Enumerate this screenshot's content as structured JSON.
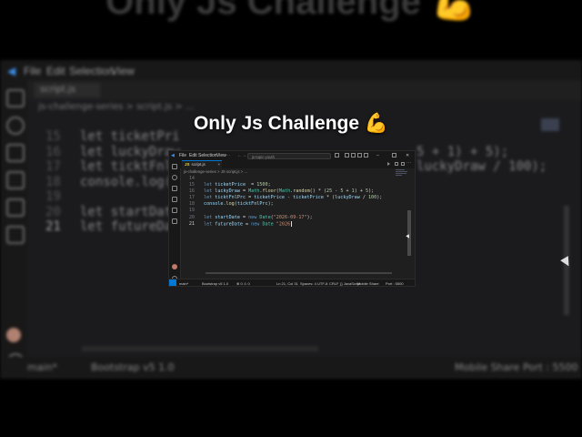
{
  "video": {
    "overlay_title": "Only Js Challenge 💪",
    "top_caption_partial": "Only Js Challenge 💪"
  },
  "background": {
    "menu": [
      "File",
      "Edit",
      "Selection",
      "View"
    ],
    "tab_label": "script.js",
    "breadcrumb": "js-challenge-series > script.js > ...",
    "code_left": [
      {
        "ln": "15",
        "text": "let ticketPri"
      },
      {
        "ln": "16",
        "text": "let luckyDraw"
      },
      {
        "ln": "17",
        "text": "let ticktFnlP"
      },
      {
        "ln": "18",
        "text": "console.log(t"
      },
      {
        "ln": "19",
        "text": ""
      },
      {
        "ln": "20",
        "text": "let startDate"
      },
      {
        "ln": "21",
        "text": "let futureDat"
      }
    ],
    "code_right": [
      "",
      "5 + 1) + 5);",
      "luckyDraw / 100);",
      "",
      "",
      "",
      ""
    ],
    "status": {
      "branch": "main*",
      "bootstrap": "Bootstrap v5 1.0",
      "mobile": "Mobile Share",
      "port": "Port : 5500"
    }
  },
  "editor": {
    "menu": [
      "File",
      "Edit",
      "Selection",
      "View"
    ],
    "search_placeholder": "js-topic-youth",
    "tab": {
      "icon": "JS",
      "label": "script.js",
      "close": "×"
    },
    "breadcrumb": "js-challenge-series > JS script.js > ...",
    "lines": [
      {
        "n": "14",
        "tokens": []
      },
      {
        "n": "15",
        "tokens": [
          [
            "kw",
            "let "
          ],
          [
            "var",
            "ticketPrice"
          ],
          [
            "",
            "  = "
          ],
          [
            "num",
            "1500"
          ],
          [
            "",
            ";"
          ]
        ]
      },
      {
        "n": "16",
        "tokens": [
          [
            "kw",
            "let "
          ],
          [
            "var",
            "luckyDraw"
          ],
          [
            "",
            " = "
          ],
          [
            "cls",
            "Math"
          ],
          [
            "",
            "."
          ],
          [
            "fn",
            "floor"
          ],
          [
            "",
            "("
          ],
          [
            "cls",
            "Math"
          ],
          [
            "",
            "."
          ],
          [
            "fn",
            "random"
          ],
          [
            "",
            "() * ("
          ],
          [
            "num",
            "25"
          ],
          [
            "",
            " - "
          ],
          [
            "num",
            "5"
          ],
          [
            "",
            " + "
          ],
          [
            "num",
            "1"
          ],
          [
            "",
            ") + "
          ],
          [
            "num",
            "5"
          ],
          [
            "",
            ");"
          ]
        ]
      },
      {
        "n": "17",
        "tokens": [
          [
            "kw",
            "let "
          ],
          [
            "var",
            "ticktFnlPrc"
          ],
          [
            "",
            " = "
          ],
          [
            "var",
            "ticketPrice"
          ],
          [
            "",
            " - "
          ],
          [
            "var",
            "ticketPrice"
          ],
          [
            "",
            " * ("
          ],
          [
            "var",
            "luckyDraw"
          ],
          [
            "",
            " / "
          ],
          [
            "num",
            "100"
          ],
          [
            "",
            ");"
          ]
        ]
      },
      {
        "n": "18",
        "tokens": [
          [
            "var",
            "console"
          ],
          [
            "",
            "."
          ],
          [
            "fn",
            "log"
          ],
          [
            "",
            "("
          ],
          [
            "var",
            "ticktFnlPrc"
          ],
          [
            "",
            ");"
          ]
        ]
      },
      {
        "n": "19",
        "tokens": []
      },
      {
        "n": "20",
        "tokens": [
          [
            "kw",
            "let "
          ],
          [
            "var",
            "startDate"
          ],
          [
            "",
            " = "
          ],
          [
            "kw",
            "new "
          ],
          [
            "cls",
            "Date"
          ],
          [
            "",
            "("
          ],
          [
            "str",
            "\"2026-09-17\""
          ],
          [
            "",
            ");"
          ]
        ]
      },
      {
        "n": "21",
        "tokens": [
          [
            "kw",
            "let "
          ],
          [
            "var",
            "futureDate"
          ],
          [
            "",
            " = "
          ],
          [
            "kw",
            "new "
          ],
          [
            "cls",
            "Date"
          ],
          [
            "",
            ""
          ],
          [
            "str",
            " \"2026"
          ]
        ]
      }
    ],
    "current_line": "21",
    "status": {
      "branch": "main*",
      "bootstrap": "Bootstrap v5 1.0",
      "problems": "⊗ 0 ⚠ 0",
      "position": "Ln 21, Col 31",
      "spaces": "Spaces: 4",
      "encoding": "UTF-8",
      "eol": "CRLF",
      "lang": "{} JavaScript",
      "mobile": "Mobile Share",
      "port": "Port : 5500"
    }
  }
}
